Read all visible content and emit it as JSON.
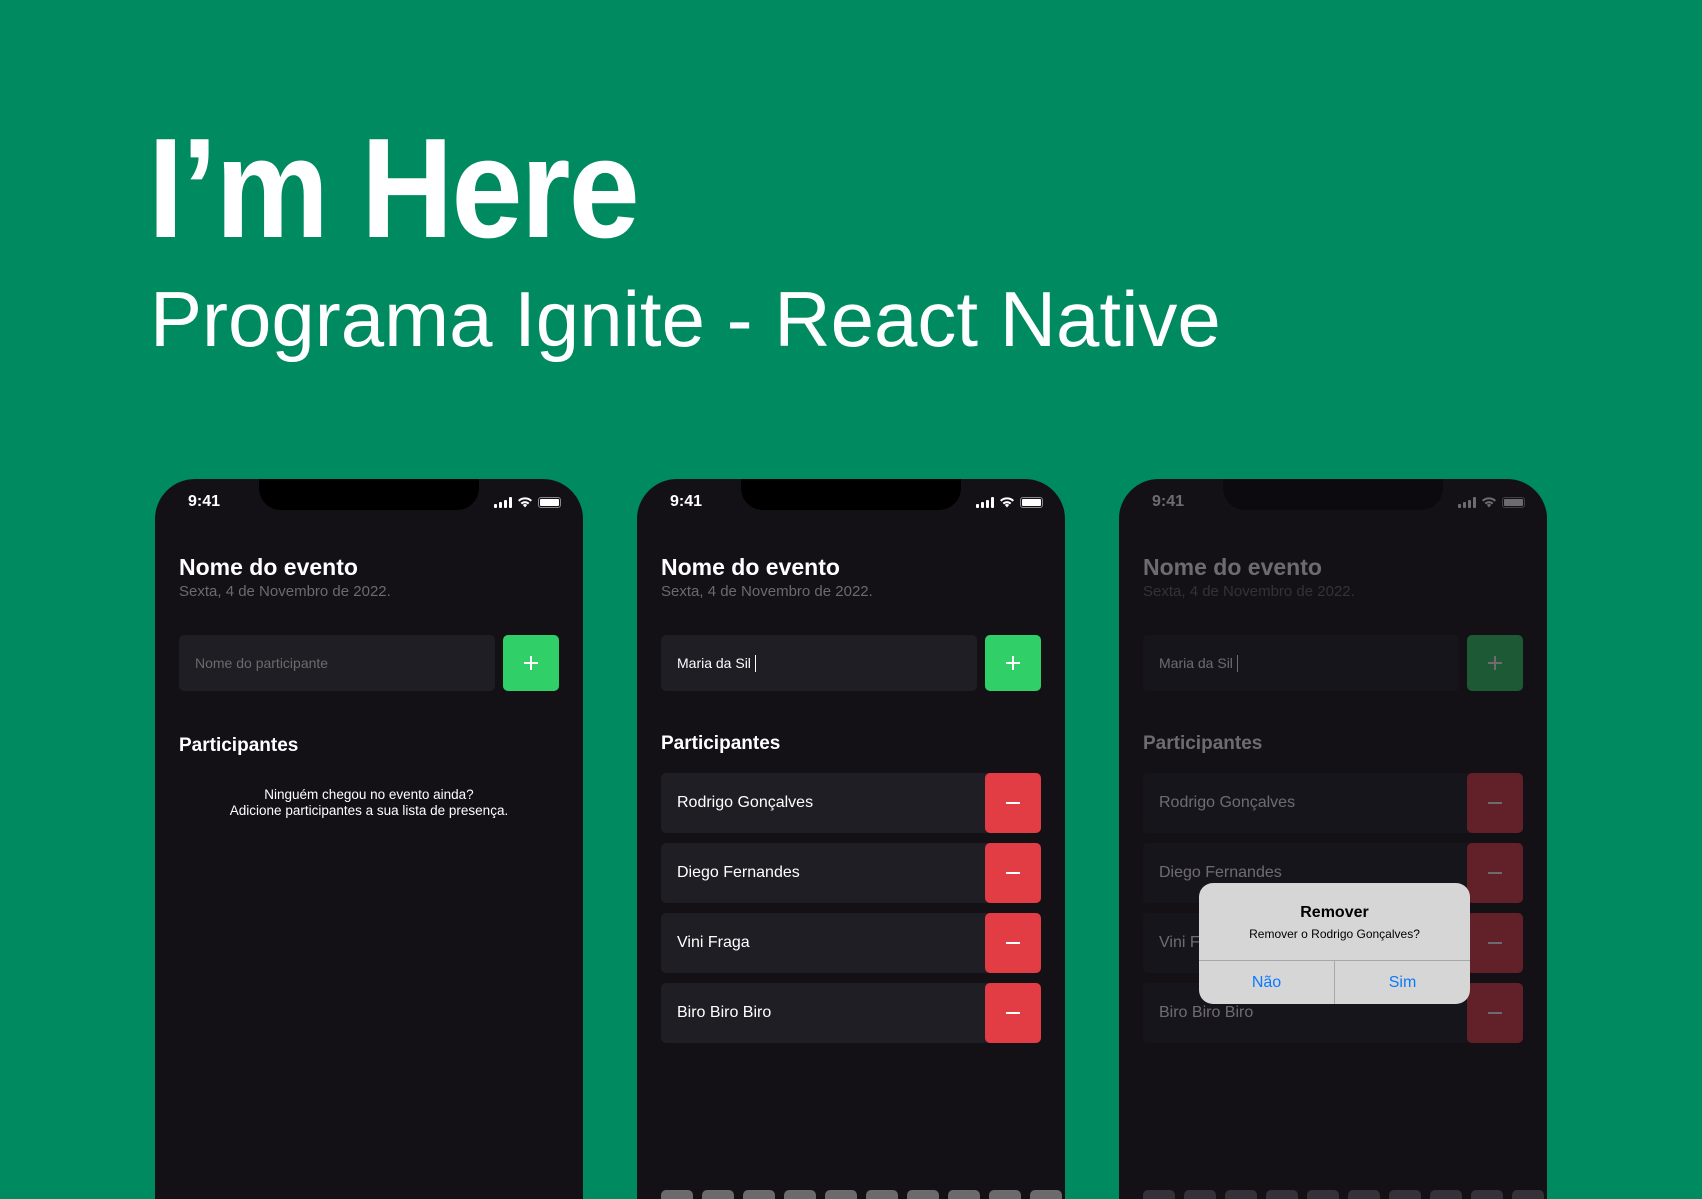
{
  "hero": {
    "title": "I’m Here",
    "subtitle": "Programa Ignite - React Native"
  },
  "colors": {
    "background": "#008a5f",
    "phone_bg": "#131016",
    "input_bg": "#1f1e25",
    "add_green": "#31cf67",
    "remove_red": "#e23c44",
    "alert_blue": "#0a7aff"
  },
  "status": {
    "time": "9:41"
  },
  "event": {
    "name": "Nome do evento",
    "date": "Sexta, 4 de Novembro de 2022."
  },
  "screen1": {
    "input_placeholder": "Nome do participante",
    "section_title": "Participantes",
    "empty_line1": "Ninguém chegou no evento ainda?",
    "empty_line2": "Adicione participantes a sua lista de presença."
  },
  "screen2": {
    "input_value": "Maria da Sil",
    "section_title": "Participantes",
    "participants": [
      "Rodrigo Gonçalves",
      "Diego Fernandes",
      "Vini Fraga",
      "Biro Biro Biro"
    ]
  },
  "screen3": {
    "input_value": "Maria da Sil",
    "section_title": "Participantes",
    "participants": [
      "Rodrigo Gonçalves",
      "Diego Fernandes",
      "Vini Fraga",
      "Biro Biro Biro"
    ],
    "alert": {
      "title": "Remover",
      "message": "Remover o Rodrigo Gonçalves?",
      "cancel_label": "Não",
      "confirm_label": "Sim"
    }
  },
  "icons": {
    "add": "plus-icon",
    "remove": "minus-icon",
    "signal": "cellular-signal-icon",
    "wifi": "wifi-icon",
    "battery": "battery-icon"
  }
}
